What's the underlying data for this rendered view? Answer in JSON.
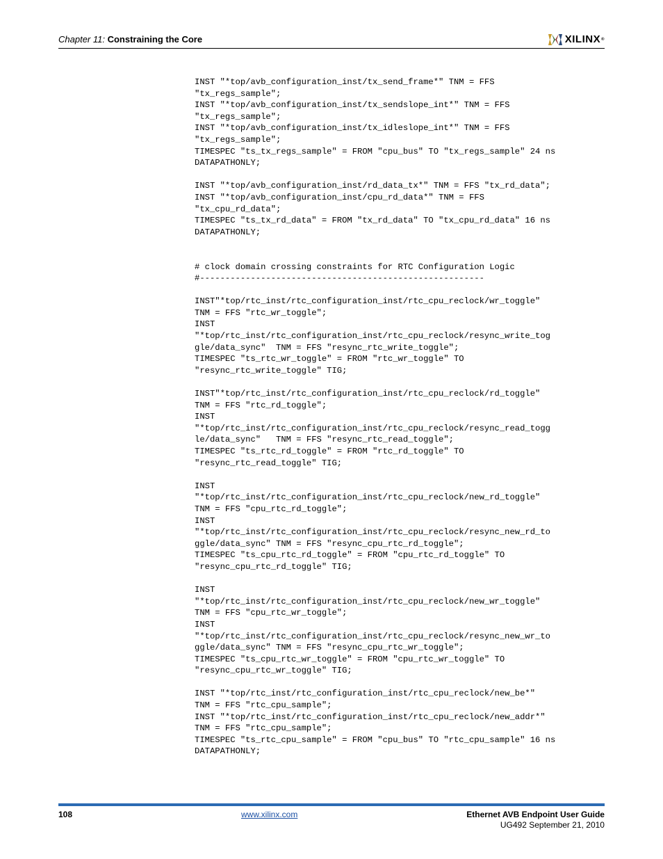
{
  "header": {
    "chapter_label": "Chapter 11:",
    "chapter_name": "Constraining the Core",
    "logo_text": "XILINX",
    "logo_reg": "®"
  },
  "code": "INST \"*top/avb_configuration_inst/tx_send_frame*\" TNM = FFS\n\"tx_regs_sample\";\nINST \"*top/avb_configuration_inst/tx_sendslope_int*\" TNM = FFS\n\"tx_regs_sample\";\nINST \"*top/avb_configuration_inst/tx_idleslope_int*\" TNM = FFS\n\"tx_regs_sample\";\nTIMESPEC \"ts_tx_regs_sample\" = FROM \"cpu_bus\" TO \"tx_regs_sample\" 24 ns\nDATAPATHONLY;\n\nINST \"*top/avb_configuration_inst/rd_data_tx*\" TNM = FFS \"tx_rd_data\";\nINST \"*top/avb_configuration_inst/cpu_rd_data*\" TNM = FFS\n\"tx_cpu_rd_data\";\nTIMESPEC \"ts_tx_rd_data\" = FROM \"tx_rd_data\" TO \"tx_cpu_rd_data\" 16 ns\nDATAPATHONLY;\n\n\n# clock domain crossing constraints for RTC Configuration Logic\n#--------------------------------------------------------\n\nINST\"*top/rtc_inst/rtc_configuration_inst/rtc_cpu_reclock/wr_toggle\"\nTNM = FFS \"rtc_wr_toggle\";\nINST\n\"*top/rtc_inst/rtc_configuration_inst/rtc_cpu_reclock/resync_write_tog\ngle/data_sync\"  TNM = FFS \"resync_rtc_write_toggle\";\nTIMESPEC \"ts_rtc_wr_toggle\" = FROM \"rtc_wr_toggle\" TO\n\"resync_rtc_write_toggle\" TIG;\n\nINST\"*top/rtc_inst/rtc_configuration_inst/rtc_cpu_reclock/rd_toggle\"\nTNM = FFS \"rtc_rd_toggle\";\nINST\n\"*top/rtc_inst/rtc_configuration_inst/rtc_cpu_reclock/resync_read_togg\nle/data_sync\"   TNM = FFS \"resync_rtc_read_toggle\";\nTIMESPEC \"ts_rtc_rd_toggle\" = FROM \"rtc_rd_toggle\" TO\n\"resync_rtc_read_toggle\" TIG;\n\nINST\n\"*top/rtc_inst/rtc_configuration_inst/rtc_cpu_reclock/new_rd_toggle\"\nTNM = FFS \"cpu_rtc_rd_toggle\";\nINST\n\"*top/rtc_inst/rtc_configuration_inst/rtc_cpu_reclock/resync_new_rd_to\nggle/data_sync\" TNM = FFS \"resync_cpu_rtc_rd_toggle\";\nTIMESPEC \"ts_cpu_rtc_rd_toggle\" = FROM \"cpu_rtc_rd_toggle\" TO\n\"resync_cpu_rtc_rd_toggle\" TIG;\n\nINST\n\"*top/rtc_inst/rtc_configuration_inst/rtc_cpu_reclock/new_wr_toggle\"\nTNM = FFS \"cpu_rtc_wr_toggle\";\nINST\n\"*top/rtc_inst/rtc_configuration_inst/rtc_cpu_reclock/resync_new_wr_to\nggle/data_sync\" TNM = FFS \"resync_cpu_rtc_wr_toggle\";\nTIMESPEC \"ts_cpu_rtc_wr_toggle\" = FROM \"cpu_rtc_wr_toggle\" TO\n\"resync_cpu_rtc_wr_toggle\" TIG;\n\nINST \"*top/rtc_inst/rtc_configuration_inst/rtc_cpu_reclock/new_be*\"\nTNM = FFS \"rtc_cpu_sample\";\nINST \"*top/rtc_inst/rtc_configuration_inst/rtc_cpu_reclock/new_addr*\"\nTNM = FFS \"rtc_cpu_sample\";\nTIMESPEC \"ts_rtc_cpu_sample\" = FROM \"cpu_bus\" TO \"rtc_cpu_sample\" 16 ns\nDATAPATHONLY;",
  "footer": {
    "page_number": "108",
    "link_text": "www.xilinx.com",
    "doc_title": "Ethernet AVB Endpoint User Guide",
    "doc_id": "UG492 September 21, 2010"
  }
}
